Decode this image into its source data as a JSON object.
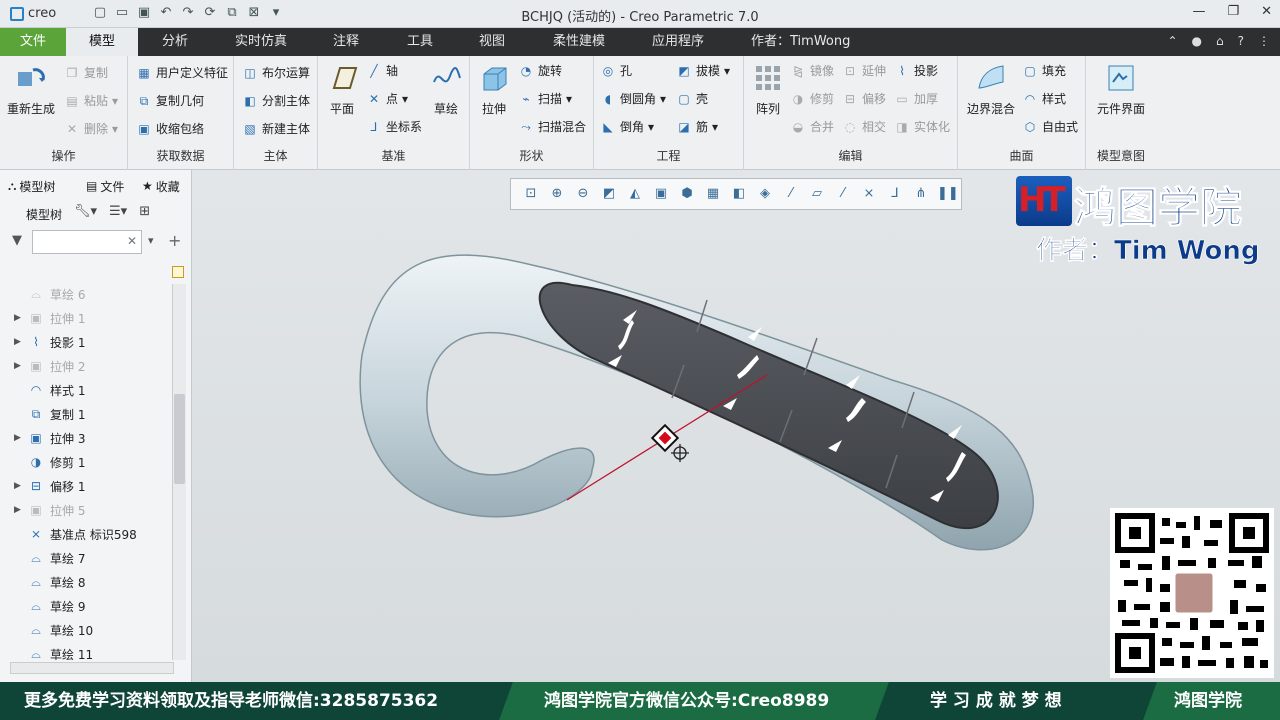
{
  "window": {
    "title": "BCHJQ (活动的) - Creo Parametric 7.0",
    "app": "creo"
  },
  "tabs": [
    {
      "label": "文件"
    },
    {
      "label": "模型"
    },
    {
      "label": "分析"
    },
    {
      "label": "实时仿真"
    },
    {
      "label": "注释"
    },
    {
      "label": "工具"
    },
    {
      "label": "视图"
    },
    {
      "label": "柔性建模"
    },
    {
      "label": "应用程序"
    },
    {
      "label": "作者：TimWong"
    }
  ],
  "ribbon": {
    "ops": {
      "regen": "重新生成",
      "copy": "复制",
      "paste": "粘贴",
      "del": "删除",
      "label": "操作"
    },
    "get": {
      "udf": "用户定义特征",
      "copygeom": "复制几何",
      "shrink": "收缩包络",
      "label": "获取数据"
    },
    "body": {
      "bool": "布尔运算",
      "split": "分割主体",
      "newbody": "新建主体",
      "label": "主体"
    },
    "datum": {
      "plane": "平面",
      "axis": "轴",
      "point": "点",
      "csys": "坐标系",
      "sketch": "草绘",
      "label": "基准"
    },
    "shapes": {
      "extrude": "拉伸",
      "revolve": "旋转",
      "sweep": "扫描",
      "sweepblend": "扫描混合",
      "label": "形状"
    },
    "eng": {
      "hole": "孔",
      "round": "倒圆角",
      "chamfer": "倒角",
      "draft": "拔模",
      "shell": "壳",
      "rib": "筋",
      "label": "工程"
    },
    "edit": {
      "pattern": "阵列",
      "mirror": "镜像",
      "trim": "修剪",
      "merge": "合并",
      "extend": "延伸",
      "offset": "偏移",
      "intersect": "相交",
      "project": "投影",
      "thicken": "加厚",
      "solidify": "实体化",
      "label": "编辑"
    },
    "surf": {
      "bblend": "边界混合",
      "fill": "填充",
      "style": "样式",
      "freestyle": "自由式",
      "label": "曲面"
    },
    "intent": {
      "ui": "元件界面",
      "label": "模型意图"
    }
  },
  "left": {
    "tabs": [
      "模型树",
      "文件",
      "收藏"
    ],
    "tree_label": "模型树",
    "items": [
      {
        "label": "草绘 6",
        "grey": true
      },
      {
        "label": "拉伸 1",
        "grey": true
      },
      {
        "label": "投影 1",
        "grey": false
      },
      {
        "label": "拉伸 2",
        "grey": true
      },
      {
        "label": "样式 1",
        "grey": false
      },
      {
        "label": "复制 1",
        "grey": false
      },
      {
        "label": "拉伸 3",
        "grey": false
      },
      {
        "label": "修剪 1",
        "grey": false
      },
      {
        "label": "偏移 1",
        "grey": false
      },
      {
        "label": "拉伸 5",
        "grey": true
      },
      {
        "label": "基准点 标识598",
        "grey": false
      },
      {
        "label": "草绘 7",
        "grey": false
      },
      {
        "label": "草绘 8",
        "grey": false
      },
      {
        "label": "草绘 9",
        "grey": false
      },
      {
        "label": "草绘 10",
        "grey": false
      },
      {
        "label": "草绘 11",
        "grey": false
      }
    ]
  },
  "watermark": {
    "brand": "鸿图学院",
    "author": "作者：Tim Wong"
  },
  "footer": {
    "left": "更多免费学习资料领取及指导老师微信:3285875362",
    "mid": "鸿图学院官方微信公众号:Creo8989",
    "slogan": "学 习 成 就 梦 想",
    "brand": "鸿图学院"
  },
  "colors": {
    "file_tab": "#5aa43a",
    "tabbar": "#2d2f31",
    "footer": "#0f4536",
    "model": "#c7d4da",
    "pad": "#4a4d53"
  }
}
